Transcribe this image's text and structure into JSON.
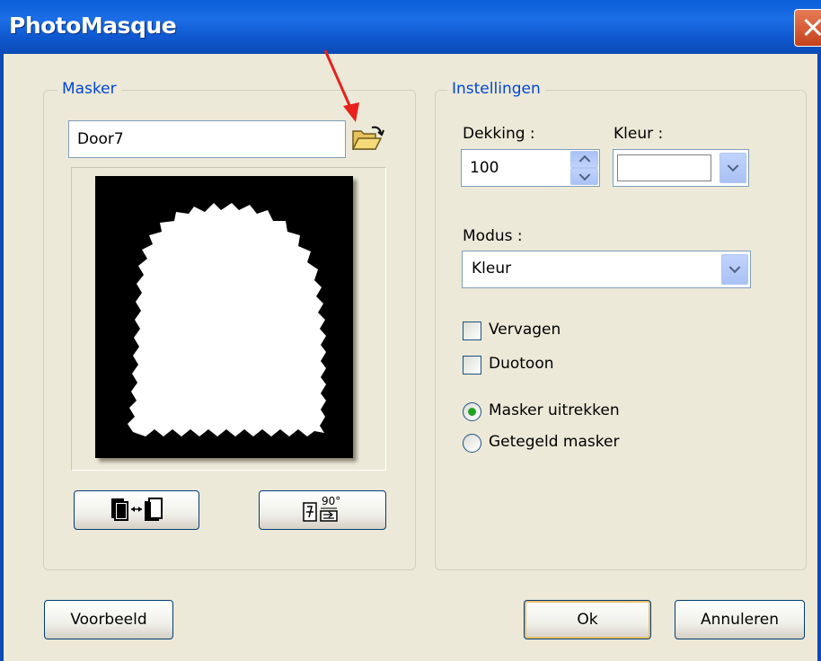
{
  "window": {
    "title": "PhotoMasque"
  },
  "masker": {
    "legend": "Masker",
    "file_value": "Door7",
    "open_icon": "folder-open-icon",
    "invert_icon": "invert-swap-icon",
    "rotate_label": "90°",
    "rotate_icon": "rotate-90-icon"
  },
  "instellingen": {
    "legend": "Instellingen",
    "dekking_label": "Dekking :",
    "dekking_value": "100",
    "kleur_label": "Kleur :",
    "kleur_value": "#ffffff",
    "modus_label": "Modus :",
    "modus_value": "Kleur",
    "vervagen_label": "Vervagen",
    "vervagen_checked": false,
    "duotoon_label": "Duotoon",
    "duotoon_checked": false,
    "radio_stretch_label": "Masker uitrekken",
    "radio_tile_label": "Getegeld masker",
    "selected_radio": "Masker uitrekken"
  },
  "buttons": {
    "preview": "Voorbeeld",
    "ok": "Ok",
    "cancel": "Annuleren"
  },
  "colors": {
    "title_bar": "#0a5ed8",
    "group_label": "#0046d5",
    "annotation_arrow": "#e8201e"
  }
}
